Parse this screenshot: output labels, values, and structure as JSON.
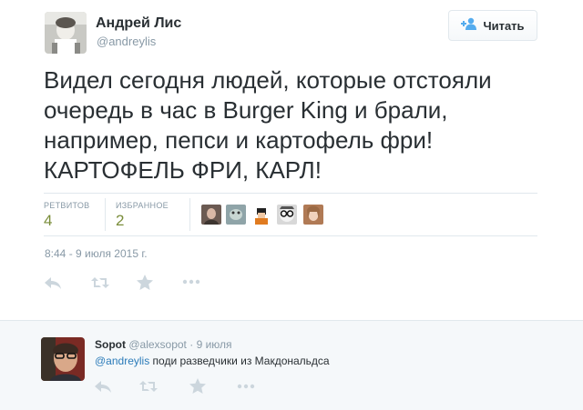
{
  "tweet": {
    "author_name": "Андрей Лис",
    "author_handle": "@andreylis",
    "follow_label": "Читать",
    "text_lines": [
      "Видел сегодня людей, которые отстояли",
      "очередь в час в Burger King и брали,",
      "например, пепси и картофель фри!",
      "КАРТОФЕЛЬ ФРИ, КАРЛ!"
    ],
    "stats": {
      "retweets_label": "РЕТВИТОВ",
      "retweets_value": "4",
      "favorites_label": "ИЗБРАННОЕ",
      "favorites_value": "2"
    },
    "timestamp": "8:44 - 9 июля 2015 г.",
    "actions": [
      "reply-icon",
      "retweet-icon",
      "favorite-icon",
      "more-icon"
    ]
  },
  "reply": {
    "author_name": "Sopot",
    "author_handle": "@alexsopot",
    "separator": "·",
    "time": "9 июля",
    "mention": "@andreylis",
    "text": " поди разведчики из Макдональдса",
    "actions": [
      "reply-icon",
      "retweet-icon",
      "favorite-icon",
      "more-icon"
    ]
  },
  "colors": {
    "stat_value": "#7a8d3a",
    "muted": "#8899a6",
    "link": "#2b7bb9",
    "text": "#292f33"
  }
}
